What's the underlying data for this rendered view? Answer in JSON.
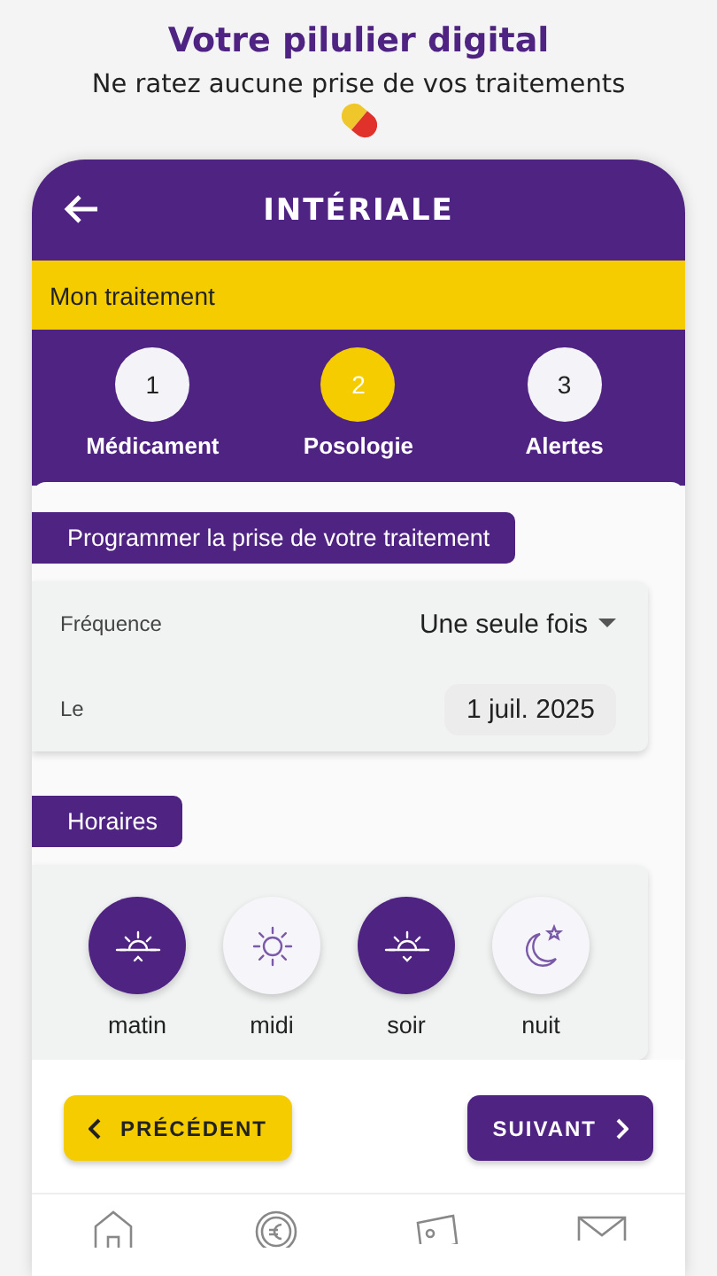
{
  "promo": {
    "title": "Votre pilulier digital",
    "subtitle": "Ne ratez aucune prise de vos traitements"
  },
  "header": {
    "logo": "INTÉRIALE"
  },
  "section_bar": {
    "title": "Mon traitement"
  },
  "steps": [
    {
      "number": "1",
      "label": "Médicament",
      "selected": false
    },
    {
      "number": "2",
      "label": "Posologie",
      "selected": true
    },
    {
      "number": "3",
      "label": "Alertes",
      "selected": false
    }
  ],
  "schedule": {
    "heading": "Programmer la prise de votre traitement",
    "frequency_label": "Fréquence",
    "frequency_value": "Une seule fois",
    "date_label": "Le",
    "date_value": "1 juil. 2025"
  },
  "times": {
    "heading": "Horaires",
    "items": [
      {
        "kind": "sunrise",
        "label": "matin",
        "selected": true
      },
      {
        "kind": "sun",
        "label": "midi",
        "selected": false
      },
      {
        "kind": "sunset",
        "label": "soir",
        "selected": true
      },
      {
        "kind": "moon",
        "label": "nuit",
        "selected": false
      }
    ]
  },
  "buttons": {
    "previous": "PRÉCÉDENT",
    "next": "SUIVANT"
  },
  "bottom_nav": [
    {
      "kind": "home"
    },
    {
      "kind": "coin"
    },
    {
      "kind": "bill"
    },
    {
      "kind": "mail"
    }
  ]
}
